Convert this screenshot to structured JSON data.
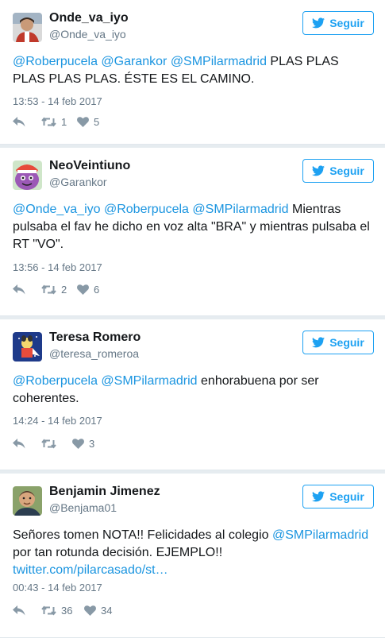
{
  "colors": {
    "accent": "#1da1f2",
    "link": "#1b95e0",
    "muted": "#657786",
    "divider": "#e6ecf0"
  },
  "follow_label": "Seguir",
  "tweets": [
    {
      "name": "Onde_va_iyo",
      "handle": "@Onde_va_iyo",
      "text": [
        {
          "m": "@Roberpucela"
        },
        {
          "t": " "
        },
        {
          "m": "@Garankor"
        },
        {
          "t": " "
        },
        {
          "m": "@SMPilarmadrid"
        },
        {
          "t": " PLAS PLAS PLAS PLAS PLAS. ÉSTE ES EL CAMINO."
        }
      ],
      "time": "13:53 - 14 feb 2017",
      "retweets": "1",
      "likes": "5"
    },
    {
      "name": "NeoVeintiuno",
      "handle": "@Garankor",
      "text": [
        {
          "m": "@Onde_va_iyo"
        },
        {
          "t": " "
        },
        {
          "m": "@Roberpucela"
        },
        {
          "t": " "
        },
        {
          "m": "@SMPilarmadrid"
        },
        {
          "t": " Mientras pulsaba el fav he dicho en voz alta \"BRA\" y mientras pulsaba el RT \"VO\"."
        }
      ],
      "time": "13:56 - 14 feb 2017",
      "retweets": "2",
      "likes": "6"
    },
    {
      "name": "Teresa Romero",
      "handle": "@teresa_romeroa",
      "text": [
        {
          "m": "@Roberpucela"
        },
        {
          "t": " "
        },
        {
          "m": "@SMPilarmadrid"
        },
        {
          "t": " enhorabuena por ser coherentes."
        }
      ],
      "time": "14:24 - 14 feb 2017",
      "retweets": "",
      "likes": "3"
    },
    {
      "name": "Benjamin Jimenez",
      "handle": "@Benjama01",
      "text": [
        {
          "t": "Señores tomen NOTA!! Felicidades al colegio "
        },
        {
          "m": "@SMPilarmadrid"
        },
        {
          "t": " por tan rotunda decisión. EJEMPLO!! "
        },
        {
          "l": "twitter.com/pilarcasado/st…"
        }
      ],
      "time": "00:43 - 14 feb 2017",
      "retweets": "36",
      "likes": "34"
    }
  ]
}
